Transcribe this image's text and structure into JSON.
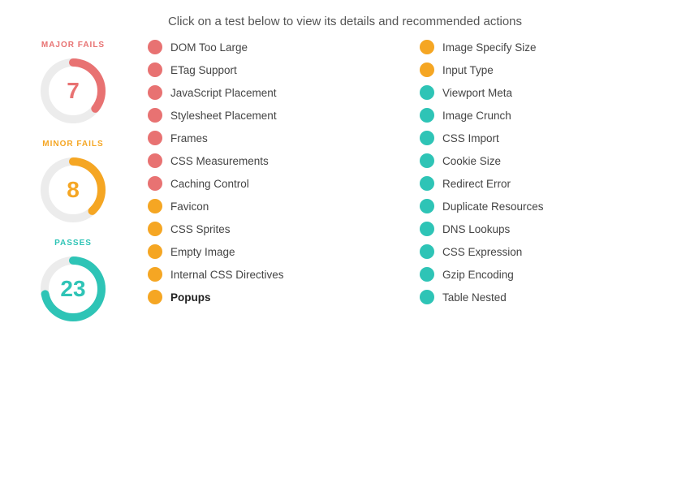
{
  "header": {
    "text": "Click on a test below to view its details and recommended actions"
  },
  "stats": {
    "major": {
      "label": "MAJOR FAILS",
      "value": "7",
      "color": "#e87272",
      "bg_color": "#f0f0f0",
      "arc_pct": 0.35
    },
    "minor": {
      "label": "MINOR FAILS",
      "value": "8",
      "color": "#f5a623",
      "bg_color": "#f0f0f0",
      "arc_pct": 0.38
    },
    "passes": {
      "label": "PASSES",
      "value": "23",
      "color": "#2ec4b6",
      "bg_color": "#f0f0f0",
      "arc_pct": 0.72
    }
  },
  "left_column": [
    {
      "label": "DOM Too Large",
      "dot": "red",
      "bold": false
    },
    {
      "label": "ETag Support",
      "dot": "red",
      "bold": false
    },
    {
      "label": "JavaScript Placement",
      "dot": "red",
      "bold": false
    },
    {
      "label": "Stylesheet Placement",
      "dot": "red",
      "bold": false
    },
    {
      "label": "Frames",
      "dot": "red",
      "bold": false
    },
    {
      "label": "CSS Measurements",
      "dot": "red",
      "bold": false
    },
    {
      "label": "Caching Control",
      "dot": "red",
      "bold": false
    },
    {
      "label": "Favicon",
      "dot": "orange",
      "bold": false
    },
    {
      "label": "CSS Sprites",
      "dot": "orange",
      "bold": false
    },
    {
      "label": "Empty Image",
      "dot": "orange",
      "bold": false
    },
    {
      "label": "Internal CSS Directives",
      "dot": "orange",
      "bold": false
    },
    {
      "label": "Popups",
      "dot": "orange",
      "bold": true
    }
  ],
  "right_column": [
    {
      "label": "Image Specify Size",
      "dot": "orange",
      "bold": false
    },
    {
      "label": "Input Type",
      "dot": "orange",
      "bold": false
    },
    {
      "label": "Viewport Meta",
      "dot": "teal",
      "bold": false
    },
    {
      "label": "Image Crunch",
      "dot": "teal",
      "bold": false
    },
    {
      "label": "CSS Import",
      "dot": "teal",
      "bold": false
    },
    {
      "label": "Cookie Size",
      "dot": "teal",
      "bold": false
    },
    {
      "label": "Redirect Error",
      "dot": "teal",
      "bold": false
    },
    {
      "label": "Duplicate Resources",
      "dot": "teal",
      "bold": false
    },
    {
      "label": "DNS Lookups",
      "dot": "teal",
      "bold": false
    },
    {
      "label": "CSS Expression",
      "dot": "teal",
      "bold": false
    },
    {
      "label": "Gzip Encoding",
      "dot": "teal",
      "bold": false
    },
    {
      "label": "Table Nested",
      "dot": "teal",
      "bold": false
    }
  ]
}
